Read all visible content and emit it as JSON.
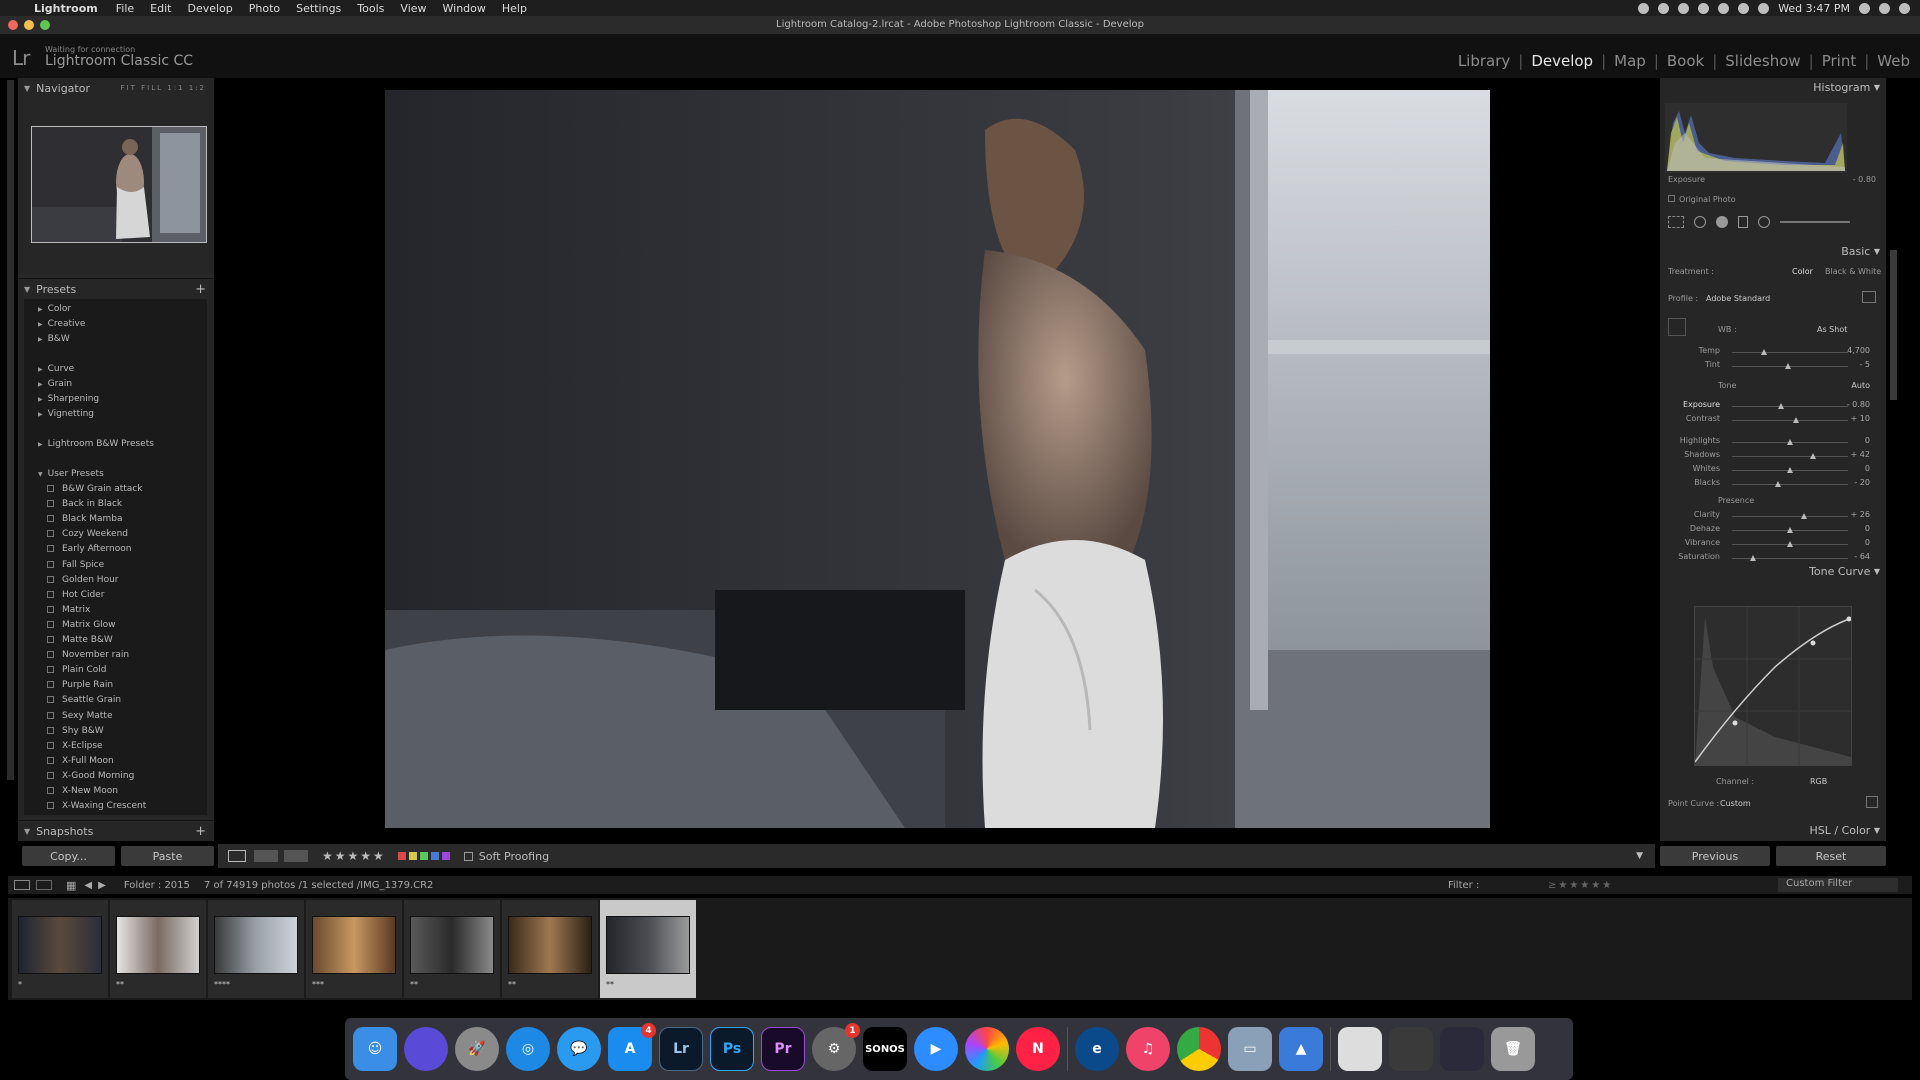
{
  "menubar": {
    "app": "Lightroom",
    "items": [
      "File",
      "Edit",
      "Develop",
      "Photo",
      "Settings",
      "Tools",
      "View",
      "Window",
      "Help"
    ],
    "clock": "Wed 3:47 PM"
  },
  "window": {
    "title": "Lightroom Catalog-2.lrcat - Adobe Photoshop Lightroom Classic - Develop"
  },
  "identity": {
    "status": "Waiting for connection",
    "product": "Lightroom Classic CC"
  },
  "modules": [
    "Library",
    "Develop",
    "Map",
    "Book",
    "Slideshow",
    "Print",
    "Web"
  ],
  "active_module": "Develop",
  "navigator": {
    "title": "Navigator",
    "options": [
      "FIT",
      "FILL",
      "1:1",
      "1:2"
    ]
  },
  "presets": {
    "title": "Presets",
    "groups": [
      "Color",
      "Creative",
      "B&W",
      "Curve",
      "Grain",
      "Sharpening",
      "Vignetting",
      "Lightroom B&W Presets"
    ],
    "user_title": "User Presets",
    "user": [
      "B&W Grain attack",
      "Back in Black",
      "Black Mamba",
      "Cozy Weekend",
      "Early Afternoon",
      "Fall Spice",
      "Golden Hour",
      "Hot Cider",
      "Matrix",
      "Matrix Glow",
      "Matte B&W",
      "November rain",
      "Plain Cold",
      "Purple Rain",
      "Seattle Grain",
      "Sexy Matte",
      "Shy B&W",
      "X-Eclipse",
      "X-Full Moon",
      "X-Good Morning",
      "X-New Moon",
      "X-Waxing Crescent"
    ]
  },
  "snapshots": {
    "title": "Snapshots"
  },
  "left_buttons": {
    "copy": "Copy...",
    "paste": "Paste"
  },
  "toolbar": {
    "soft_proofing": "Soft Proofing"
  },
  "histogram": {
    "title": "Histogram",
    "exposure_label": "Exposure",
    "exposure_value": "- 0.80",
    "original": "Original Photo"
  },
  "basic": {
    "title": "Basic",
    "treatment_label": "Treatment :",
    "color": "Color",
    "bw": "Black & White",
    "profile_label": "Profile :",
    "profile": "Adobe Standard",
    "wb_label": "WB :",
    "wb": "As Shot",
    "tone": "Tone",
    "auto": "Auto",
    "presence": "Presence",
    "sliders": [
      {
        "label": "Temp",
        "value": "4,700",
        "pos": 0.28
      },
      {
        "label": "Tint",
        "value": "- 5",
        "pos": 0.48
      },
      {
        "label": "Exposure",
        "value": "- 0.80",
        "pos": 0.42
      },
      {
        "label": "Contrast",
        "value": "+ 10",
        "pos": 0.55
      },
      {
        "label": "Highlights",
        "value": "0",
        "pos": 0.5
      },
      {
        "label": "Shadows",
        "value": "+ 42",
        "pos": 0.7
      },
      {
        "label": "Whites",
        "value": "0",
        "pos": 0.5
      },
      {
        "label": "Blacks",
        "value": "- 20",
        "pos": 0.4
      },
      {
        "label": "Clarity",
        "value": "+ 26",
        "pos": 0.62
      },
      {
        "label": "Dehaze",
        "value": "0",
        "pos": 0.5
      },
      {
        "label": "Vibrance",
        "value": "0",
        "pos": 0.5
      },
      {
        "label": "Saturation",
        "value": "- 64",
        "pos": 0.18
      }
    ]
  },
  "tone_curve": {
    "title": "Tone Curve",
    "channel_label": "Channel :",
    "channel": "RGB",
    "point_curve_label": "Point Curve :",
    "point_curve": "Custom"
  },
  "hsl": {
    "title": "HSL / Color"
  },
  "right_buttons": {
    "previous": "Previous",
    "reset": "Reset"
  },
  "filmstrip_bar": {
    "folder": "Folder : 2015",
    "count": "7 of 74919 photos /1 selected /IMG_1379.CR2",
    "filter_label": "Filter :",
    "custom_filter": "Custom Filter"
  },
  "film": [
    {
      "stars": "*"
    },
    {
      "stars": "**"
    },
    {
      "stars": "****"
    },
    {
      "stars": "***"
    },
    {
      "stars": "**"
    },
    {
      "stars": "**"
    },
    {
      "stars": "**"
    }
  ],
  "dock": {
    "badges": {
      "appstore": "4",
      "sysprefs": "1"
    },
    "labels": {
      "lr": "Lr",
      "ps": "Ps",
      "pr": "Pr",
      "sonos": "SONOS"
    }
  }
}
